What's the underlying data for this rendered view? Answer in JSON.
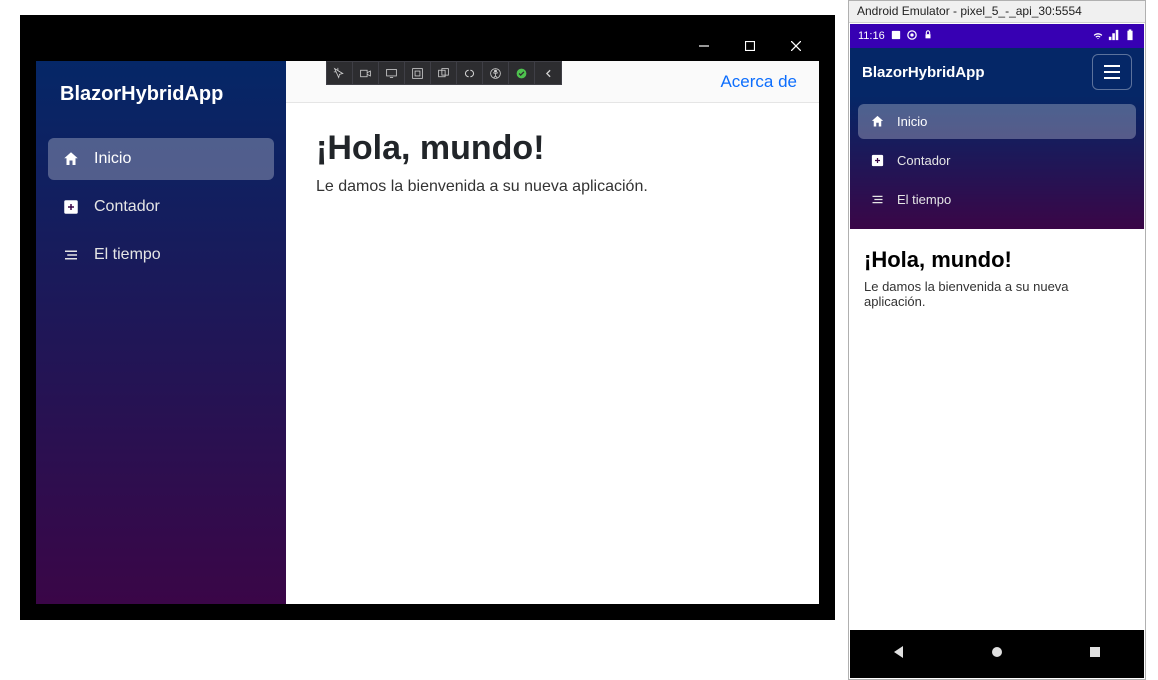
{
  "desktop": {
    "app_title": "BlazorHybridApp",
    "sidebar": {
      "items": [
        {
          "icon": "home-icon",
          "label": "Inicio",
          "active": true
        },
        {
          "icon": "plus-icon",
          "label": "Contador",
          "active": false
        },
        {
          "icon": "list-icon",
          "label": "El tiempo",
          "active": false
        }
      ]
    },
    "top_row": {
      "about_label": "Acerca de"
    },
    "content": {
      "heading": "¡Hola, mundo!",
      "subtext": "Le damos la bienvenida a su nueva aplicación."
    }
  },
  "emulator": {
    "window_title": "Android Emulator - pixel_5_-_api_30:5554",
    "status": {
      "time": "11:16"
    },
    "app_title": "BlazorHybridApp",
    "sidebar": {
      "items": [
        {
          "icon": "home-icon",
          "label": "Inicio",
          "active": true
        },
        {
          "icon": "plus-icon",
          "label": "Contador",
          "active": false
        },
        {
          "icon": "list-icon",
          "label": "El tiempo",
          "active": false
        }
      ]
    },
    "content": {
      "heading": "¡Hola, mundo!",
      "subtext": "Le damos la bienvenida a su nueva aplicación."
    }
  },
  "colors": {
    "sidebar_grad_top": "#052767",
    "sidebar_grad_bottom": "#3a0647",
    "link": "#0d6efd",
    "android_status": "#3700b3"
  }
}
